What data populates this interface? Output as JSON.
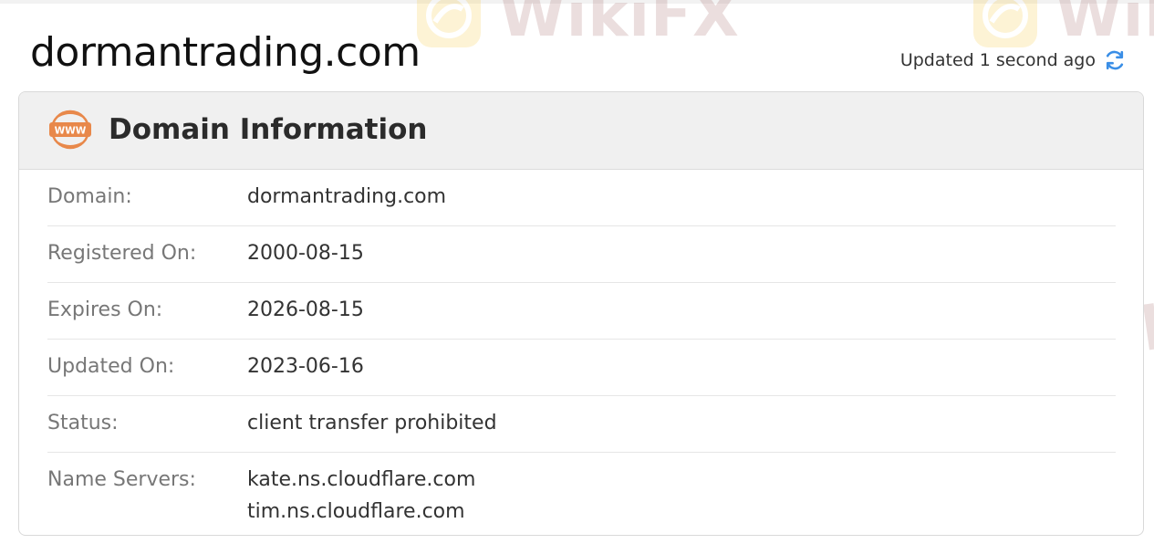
{
  "page": {
    "title": "dormantrading.com",
    "updated_text": "Updated 1 second ago"
  },
  "card": {
    "title": "Domain Information",
    "icon": "www-icon",
    "rows": [
      {
        "label": "Domain:",
        "value": "dormantrading.com"
      },
      {
        "label": "Registered On:",
        "value": "2000-08-15"
      },
      {
        "label": "Expires On:",
        "value": "2026-08-15"
      },
      {
        "label": "Updated On:",
        "value": "2023-06-16"
      },
      {
        "label": "Status:",
        "value": "client transfer prohibited"
      },
      {
        "label": "Name Servers:",
        "values": [
          "kate.ns.cloudflare.com",
          "tim.ns.cloudflare.com"
        ]
      }
    ]
  },
  "watermark": {
    "text": "WikiFX",
    "text_color": "#8a3b3b",
    "logo_color": "#f5b800"
  },
  "colors": {
    "accent_icon": "#e8884a",
    "refresh_icon": "#3a8ee6",
    "header_bg": "#f0f0f0",
    "label": "#777777"
  }
}
